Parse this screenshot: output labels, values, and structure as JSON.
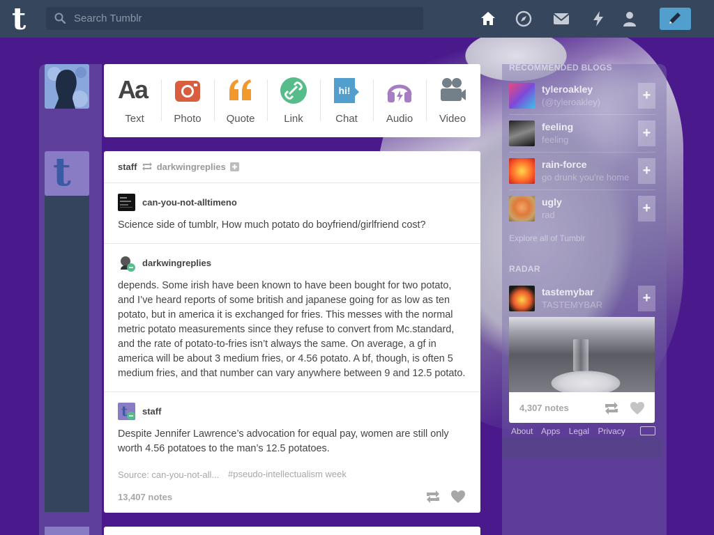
{
  "header": {
    "search_placeholder": "Search Tumblr",
    "logo": "t",
    "nav_icons": [
      "home-icon",
      "explore-icon",
      "inbox-icon",
      "activity-icon",
      "account-icon"
    ],
    "compose_icon": "pencil-icon",
    "compose_color": "#529ecc"
  },
  "post_types": [
    {
      "label": "Text",
      "icon": "Aa",
      "color": "#444444"
    },
    {
      "label": "Photo",
      "icon": "camera-icon",
      "color": "#d95e40"
    },
    {
      "label": "Quote",
      "icon": "quote-icon",
      "color": "#f2992e"
    },
    {
      "label": "Link",
      "icon": "link-icon",
      "color": "#56bc8a"
    },
    {
      "label": "Chat",
      "icon": "hi!",
      "color": "#529ecc"
    },
    {
      "label": "Audio",
      "icon": "headphones-icon",
      "color": "#a77dc2"
    },
    {
      "label": "Video",
      "icon": "video-camera-icon",
      "color": "#748089"
    }
  ],
  "post": {
    "author": "staff",
    "reblogged_from": "darkwingreplies",
    "entries": [
      {
        "user": "can-you-not-alltimeno",
        "text": "Science side of tumblr, How much potato do boyfriend/girlfriend cost?"
      },
      {
        "user": "darkwingreplies",
        "text": "depends. Some irish have been known to have been bought for two potato, and I’ve heard reports of some british and japanese going for as low as ten potato, but in america it is exchanged for fries. This messes with the normal metric potato measurements since they refuse to convert from Mc.standard, and the rate of potato-to-fries isn’t always the same. On average, a gf in america will be about 3 medium fries, or 4.56 potato. A bf, though, is often 5 medium fries, and that number can vary anywhere between 9 and 12.5 potato."
      },
      {
        "user": "staff",
        "text": "Despite Jennifer Lawrence’s advocation for equal pay, women are still only worth 4.56 potatoes to the man’s 12.5 potatoes."
      }
    ],
    "source": "Source: can-you-not-all...",
    "tag": "#pseudo-intellectualism week",
    "notes": "13,407 notes"
  },
  "sidebar": {
    "recommended_heading": "RECOMMENDED BLOGS",
    "blogs": [
      {
        "name": "tyleroakley",
        "sub": "(@tyleroakley)"
      },
      {
        "name": "feeling",
        "sub": "feeling"
      },
      {
        "name": "rain-force",
        "sub": "go drunk you're home"
      },
      {
        "name": "ugly",
        "sub": "rad"
      }
    ],
    "explore_link": "Explore all of Tumblr",
    "radar_heading": "RADAR",
    "radar": {
      "name": "tastemybar",
      "sub": "TASTEMYBAR",
      "notes": "4,307 notes"
    },
    "footer": [
      "About",
      "Apps",
      "Legal",
      "Privacy"
    ]
  }
}
